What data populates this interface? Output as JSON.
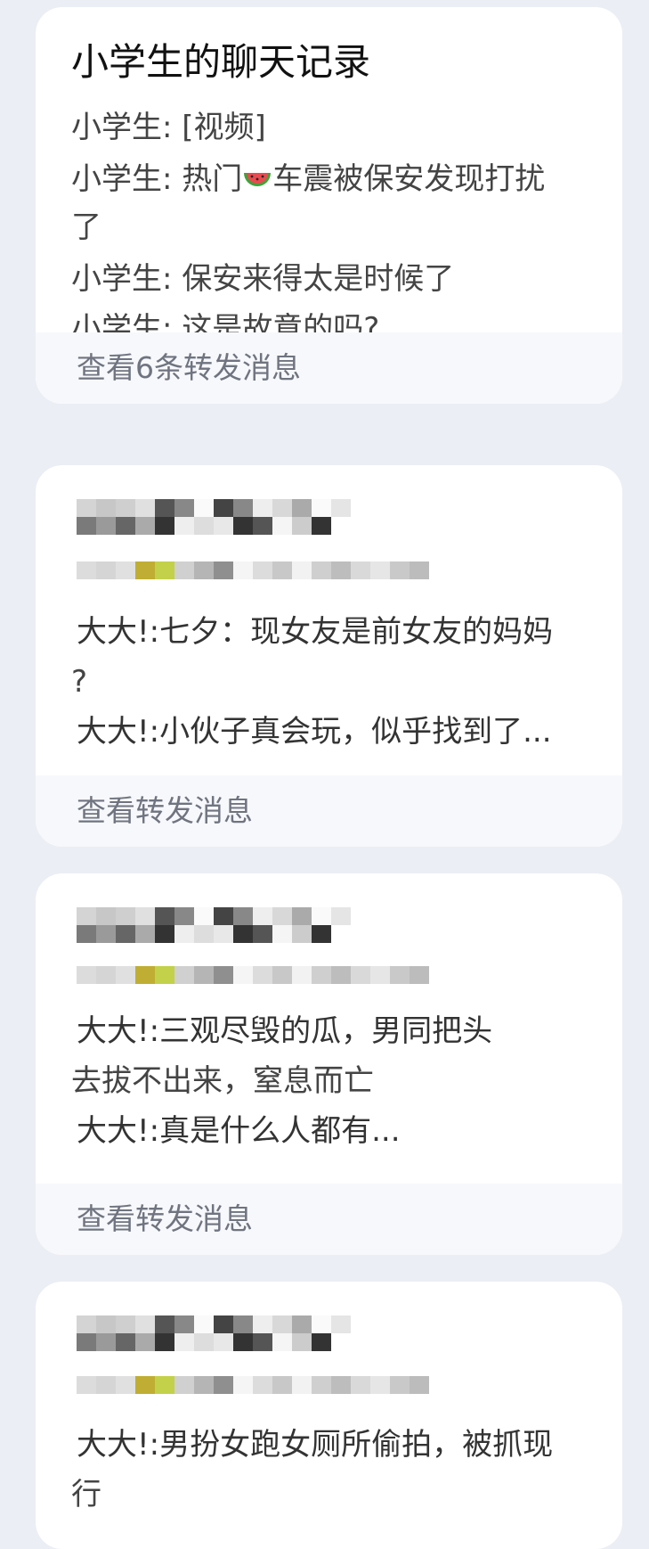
{
  "cards": [
    {
      "title": "小学生的聊天记录",
      "messages": [
        {
          "sender": "小学生",
          "text": "[视频]"
        },
        {
          "sender": "小学生",
          "text": "热门",
          "emoji": "watermelon-icon",
          "text_after": "车震被保安发现打扰",
          "wrap": "了"
        },
        {
          "sender": "小学生",
          "text": "保安来得太是时候了"
        },
        {
          "sender": "小学生",
          "text": "这是故意的吗?"
        }
      ],
      "footer": "查看6条转发消息"
    },
    {
      "messages": [
        {
          "sender": "大大!",
          "text": ":七夕：现女友是前女友的妈妈",
          "wrap": "?"
        },
        {
          "sender": "大大!",
          "text": ":小伙子真会玩，似乎找到了..."
        }
      ],
      "footer": "查看转发消息"
    },
    {
      "messages": [
        {
          "sender": "大大!",
          "text": ":三观尽毁的瓜，男同把头",
          "wrap": "去拔不出来，窒息而亡"
        },
        {
          "sender": "大大!",
          "text": ":真是什么人都有..."
        }
      ],
      "footer": "查看转发消息"
    },
    {
      "messages": [
        {
          "sender": "大大!",
          "text": ":男扮女跑女厕所偷拍，被抓现",
          "wrap": "行"
        }
      ]
    }
  ],
  "labels": {
    "sep": ": "
  },
  "colors": {
    "background": "#eceef5",
    "card": "#ffffff",
    "footer": "#f7f8fb",
    "footer_text": "#6f7480"
  }
}
